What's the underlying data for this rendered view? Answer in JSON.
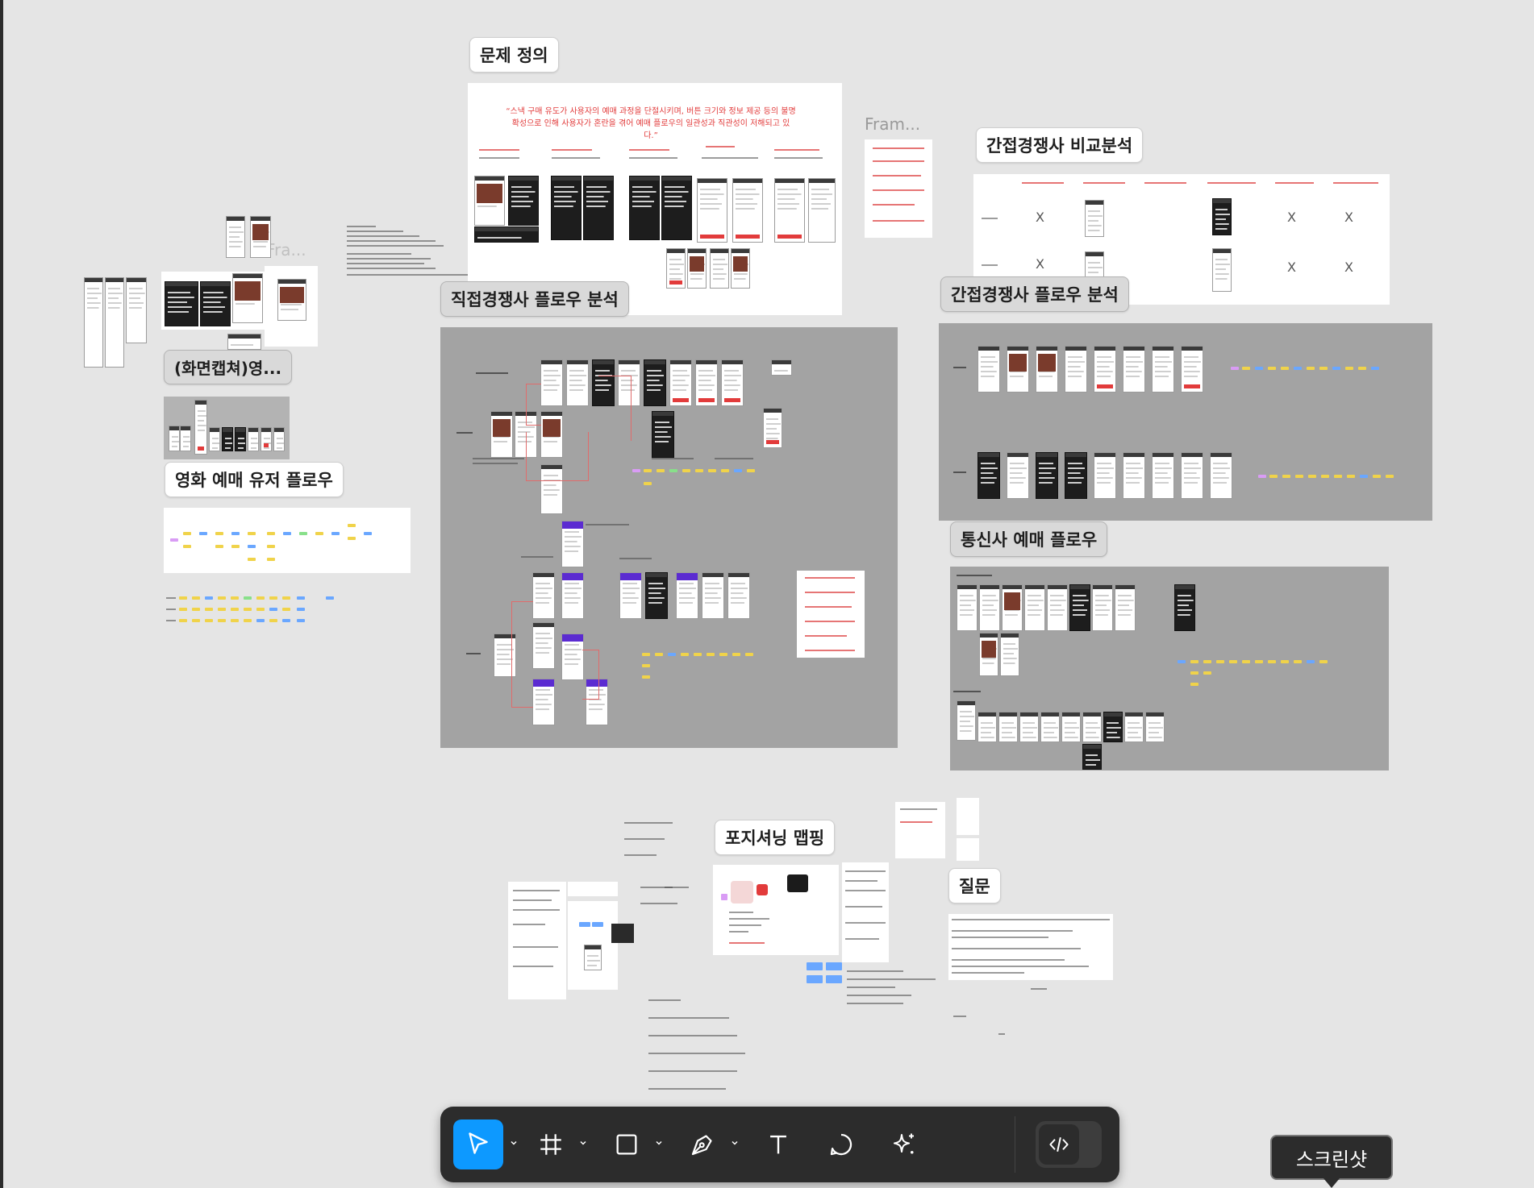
{
  "sections": {
    "problem_definition": "문제 정의",
    "direct_flow": "직접경쟁사 플로우 분석",
    "indirect_compare": "간접경쟁사 비교분석",
    "indirect_flow": "간접경쟁사 플로우 분석",
    "telecom_flow": "통신사 예매 플로우",
    "screen_capture": "(화면캡쳐)영...",
    "movie_user_flow": "영화 예매 유저 플로우",
    "positioning": "포지셔닝 맵핑",
    "questions": "질문"
  },
  "frame_names": {
    "frame_1": "Fram...",
    "frame_2": "Fra..."
  },
  "problem_quote": "“스낵 구매 유도가 사용자의 예매 과정을 단절시키며, 버튼 크기와 정보 제공 등의 불명확성으로 인해 사용자가 혼란을 겪어 예매 플로우의 일관성과 직관성이 저해되고 있다.”",
  "comparison_marks": [
    "X",
    "X",
    "X",
    "X",
    "X",
    "X"
  ],
  "toolbar": {
    "tools": [
      {
        "name": "move-tool",
        "icon": "cursor-arrow-icon"
      },
      {
        "name": "frame-tool",
        "icon": "hash-frame-icon"
      },
      {
        "name": "shape-tool",
        "icon": "square-icon"
      },
      {
        "name": "pen-tool",
        "icon": "pen-nib-icon"
      },
      {
        "name": "text-tool",
        "icon": "text-t-icon"
      },
      {
        "name": "comment-tool",
        "icon": "speech-bubble-icon"
      },
      {
        "name": "actions-tool",
        "icon": "sparkle-icon"
      },
      {
        "name": "dev-mode-toggle",
        "icon": "code-brackets-icon"
      }
    ]
  },
  "tooltip": "스크린샷",
  "colors": {
    "accent": "#0d99ff",
    "toolbar_bg": "#2c2c2c",
    "canvas_bg": "#e5e5e5",
    "quote_red": "#e23c3c"
  }
}
